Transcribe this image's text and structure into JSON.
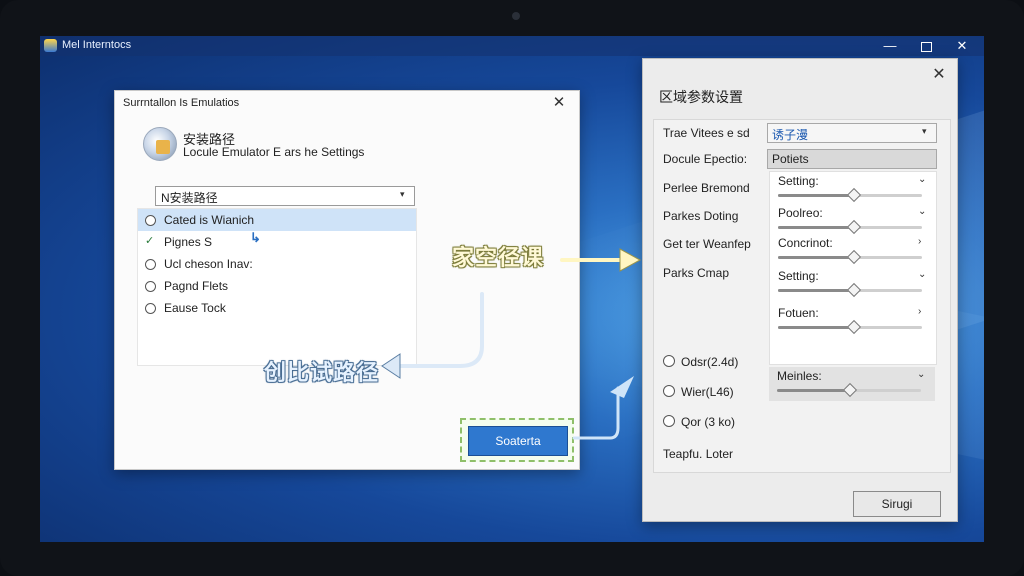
{
  "main_window": {
    "title": "Mel Interntocs",
    "minimize_glyph": "—",
    "close_glyph": "✕"
  },
  "dialog_install": {
    "title": "Surrntallon Is Emulatios",
    "close_glyph": "✕",
    "heading": "安装路径",
    "subheading": "Locule Emulator E ars he Settings",
    "path_select": {
      "value": "N安装路径",
      "arrow": "▾"
    },
    "list": [
      {
        "label": "Cated is Wianich",
        "selected": true,
        "icon": "radio-icon"
      },
      {
        "label": "Pignes S",
        "selected": false,
        "icon": "check-icon",
        "glyph": "✓"
      },
      {
        "label": "Ucl cheson Inav:",
        "selected": false,
        "icon": "radio-icon"
      },
      {
        "label": "Pagnd Flets",
        "selected": false,
        "icon": "radio-icon"
      },
      {
        "label": "Eause Tock",
        "selected": false,
        "icon": "radio-icon"
      }
    ],
    "cursor_glyph": "↳",
    "confirm_button": "Soaterta"
  },
  "annotations": {
    "right": "家空径课",
    "left": "创比试路径"
  },
  "dialog_region": {
    "title": "区域参数设置",
    "close_glyph": "✕",
    "rows": [
      {
        "label": "Trae Vitees e sd"
      },
      {
        "label": "Docule Epectio:"
      },
      {
        "label": "Perlee Bremond"
      },
      {
        "label": "Parkes Doting"
      },
      {
        "label": "Get ter Weanfep"
      },
      {
        "label": "Parks Cmap"
      }
    ],
    "combo": {
      "value": "诱子漫",
      "arrow": "▾"
    },
    "field_value": "Potiets",
    "settings": [
      {
        "name": "Setting:",
        "chevron": "⌄",
        "level": 0.52
      },
      {
        "name": "Poolreo:",
        "chevron": "⌄",
        "level": 0.52
      },
      {
        "name": "Concrinot:",
        "chevron": "›",
        "level": 0.52
      },
      {
        "name": "Setting:",
        "chevron": "⌄",
        "level": 0.52
      },
      {
        "name": "Fotuen:",
        "chevron": "›",
        "level": 0.52
      }
    ],
    "radios": [
      {
        "label": "Odsr(2.4d)"
      },
      {
        "label": "Wier(L46)"
      },
      {
        "label": "Qor (3 ko)"
      }
    ],
    "meta": {
      "name": "Meinles:",
      "chevron": "⌄",
      "level": 0.5
    },
    "footer_label": "Teapfu. Loter",
    "ok_button": "Sirugi"
  },
  "colors": {
    "accent_blue": "#2f78cf",
    "selection": "#cfe3f8",
    "annotation_yellow": "#fff9d6"
  }
}
